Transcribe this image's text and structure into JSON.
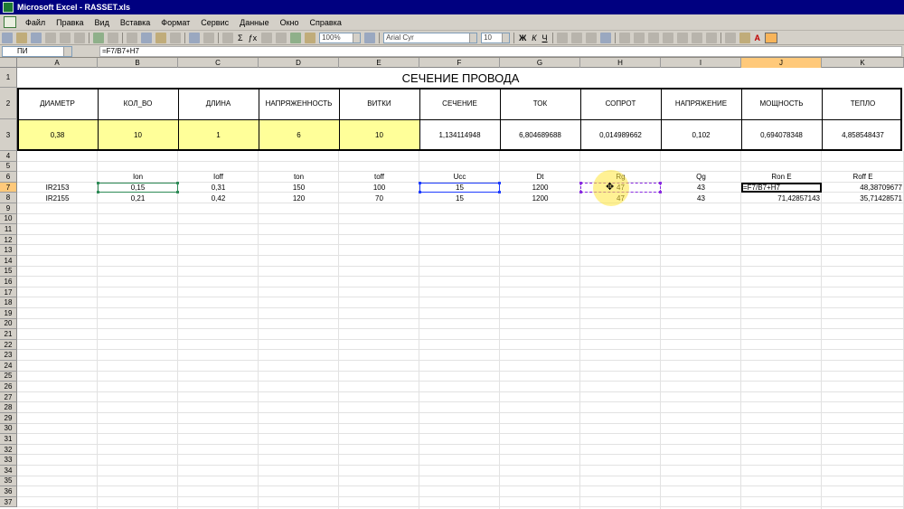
{
  "window": {
    "title": "Microsoft Excel - RASSET.xls"
  },
  "menu": [
    "Файл",
    "Правка",
    "Вид",
    "Вставка",
    "Формат",
    "Сервис",
    "Данные",
    "Окно",
    "Справка"
  ],
  "toolbar": {
    "zoom": "100%",
    "font": "Arial Cyr",
    "size": "10",
    "fill_color": "#f7b45a"
  },
  "formula_bar": {
    "name_box": "ПИ",
    "formula": "=F7/B7+H7"
  },
  "columns": [
    "A",
    "B",
    "C",
    "D",
    "E",
    "F",
    "G",
    "H",
    "I",
    "J",
    "K"
  ],
  "active_column": "J",
  "active_row": 7,
  "rows": [
    "1",
    "2",
    "3",
    "4",
    "5",
    "6",
    "7",
    "8",
    "9",
    "10",
    "11",
    "12",
    "13",
    "14",
    "15",
    "16",
    "17",
    "18",
    "19",
    "20",
    "21",
    "22",
    "23",
    "24",
    "25",
    "26",
    "27",
    "28",
    "29",
    "30",
    "31",
    "32",
    "33",
    "34",
    "35",
    "36",
    "37"
  ],
  "sheet": {
    "title": "СЕЧЕНИЕ ПРОВОДА",
    "headers": [
      "ДИАМЕТР",
      "КОЛ_ВО",
      "ДЛИНА",
      "НАПРЯЖЕННОСТЬ",
      "ВИТКИ",
      "СЕЧЕНИЕ",
      "ТОК",
      "СОПРОТ",
      "НАПРЯЖЕНИЕ",
      "МОЩНОСТЬ",
      "ТЕПЛО"
    ],
    "values": [
      "0,38",
      "10",
      "1",
      "6",
      "10",
      "1,134114948",
      "6,804689688",
      "0,014989662",
      "0,102",
      "0,694078348",
      "4,858548437"
    ],
    "row6": [
      "",
      "Ion",
      "Ioff",
      "ton",
      "toff",
      "Ucc",
      "Dt",
      "Rg",
      "Qg",
      "Ron E",
      "Roff E"
    ],
    "row7": [
      "IR2153",
      "0,15",
      "0,31",
      "150",
      "100",
      "15",
      "1200",
      "47",
      "43",
      "=F7/B7+H7",
      "48,38709677"
    ],
    "row8": [
      "IR2155",
      "0,21",
      "0,42",
      "120",
      "70",
      "15",
      "1200",
      "47",
      "43",
      "71,42857143",
      "35,71428571"
    ]
  }
}
